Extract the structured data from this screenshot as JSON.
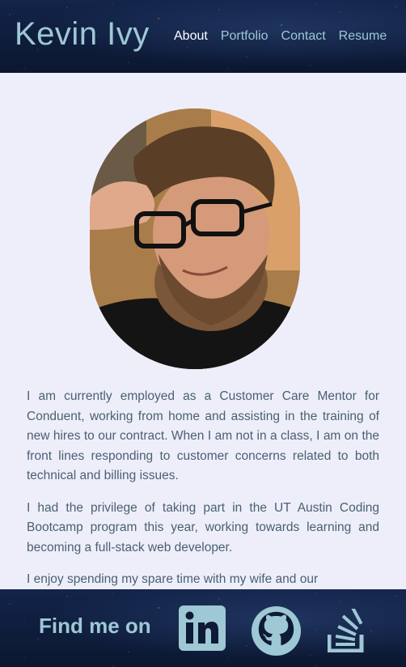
{
  "header": {
    "title": "Kevin Ivy",
    "nav": [
      {
        "label": "About",
        "active": true
      },
      {
        "label": "Portfolio",
        "active": false
      },
      {
        "label": "Contact",
        "active": false
      },
      {
        "label": "Resume",
        "active": false
      }
    ]
  },
  "about": {
    "paragraphs": [
      "I am currently employed as a Customer Care Mentor for Conduent, working from home and assisting in the training of new hires to our contract. When I am not in a class, I am on the front lines responding to customer concerns related to both technical and billing issues.",
      "I had the privilege of taking part in the UT Austin Coding Bootcamp program this year, working towards learning and becoming a full-stack web developer.",
      "I enjoy spending my spare time with my wife and our"
    ]
  },
  "footer": {
    "label": "Find me on",
    "links": [
      {
        "name": "linkedin",
        "icon": "linkedin-icon"
      },
      {
        "name": "github",
        "icon": "github-icon"
      },
      {
        "name": "stack-overflow",
        "icon": "stack-overflow-icon"
      }
    ]
  },
  "colors": {
    "accent": "#9ec8d4",
    "content_bg": "#eeeefb",
    "text": "#4a6070",
    "header_bg": "#0e1b36"
  }
}
